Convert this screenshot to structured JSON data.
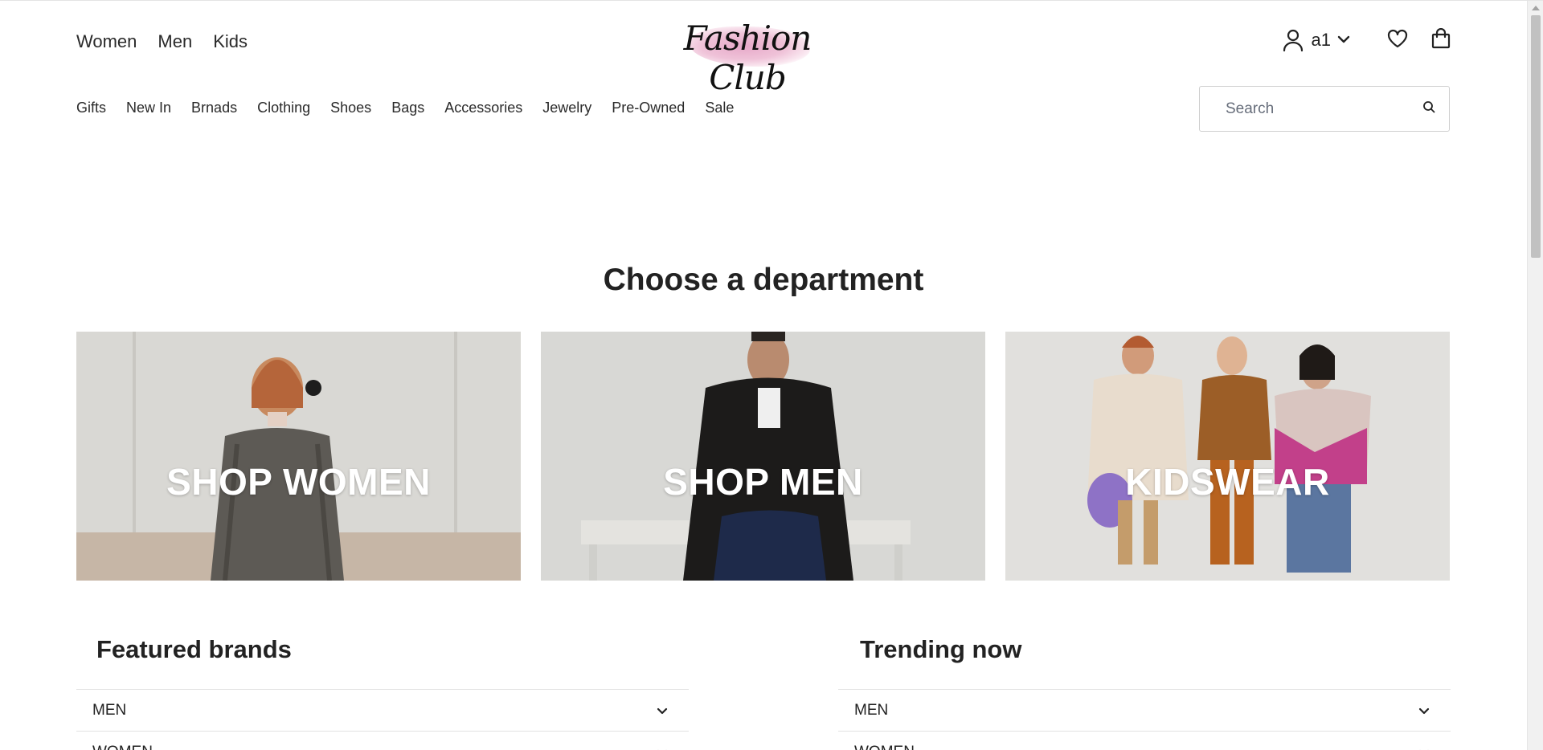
{
  "header": {
    "dept_links": [
      "Women",
      "Men",
      "Kids"
    ],
    "logo_text": "Fashion Club",
    "account_label": "a1"
  },
  "nav": {
    "categories": [
      "Gifts",
      "New In",
      "Brnads",
      "Clothing",
      "Shoes",
      "Bags",
      "Accessories",
      "Jewelry",
      "Pre-Owned",
      "Sale"
    ]
  },
  "search": {
    "placeholder": "Search"
  },
  "main": {
    "title": "Choose a department",
    "tiles": [
      {
        "label": "SHOP WOMEN"
      },
      {
        "label": "SHOP MEN"
      },
      {
        "label": "KIDSWEAR"
      }
    ]
  },
  "featured": {
    "title": "Featured brands",
    "rows": [
      "MEN",
      "WOMEN"
    ]
  },
  "trending": {
    "title": "Trending now",
    "rows": [
      "MEN",
      "WOMEN"
    ]
  },
  "colors": {
    "text": "#222222",
    "border": "#cfcfcf",
    "logo_splash": "#e7a9c9"
  }
}
